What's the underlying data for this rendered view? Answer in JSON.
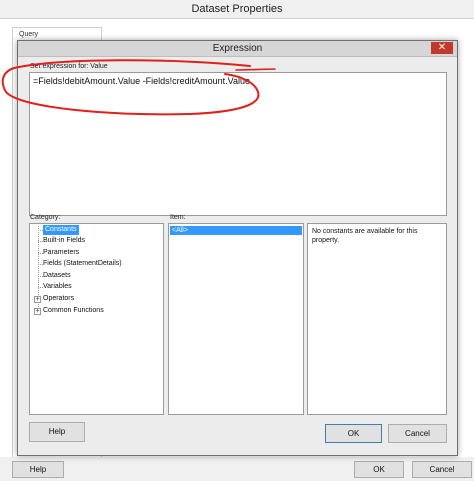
{
  "outer": {
    "title": "Dataset Properties",
    "query_label": "Query",
    "help_label": "Help",
    "ok_label": "OK",
    "cancel_label": "Cancel"
  },
  "dialog": {
    "title": "Expression",
    "close_glyph": "✕",
    "prompt": "Set expression for: Value",
    "expression": "=Fields!debitAmount.Value -Fields!creditAmount.Value",
    "category_label": "Category:",
    "item_label": "Item:",
    "categories": [
      {
        "label": "Constants",
        "selected": true,
        "expandable": false
      },
      {
        "label": "Built-in Fields",
        "selected": false,
        "expandable": false
      },
      {
        "label": "Parameters",
        "selected": false,
        "expandable": false
      },
      {
        "label": "Fields (StatementDetails)",
        "selected": false,
        "expandable": false
      },
      {
        "label": "Datasets",
        "selected": false,
        "expandable": false
      },
      {
        "label": "Variables",
        "selected": false,
        "expandable": false
      },
      {
        "label": "Operators",
        "selected": false,
        "expandable": true
      },
      {
        "label": "Common Functions",
        "selected": false,
        "expandable": true
      }
    ],
    "items": [
      "<All>"
    ],
    "description": "No constants are available for this property.",
    "help_label": "Help",
    "ok_label": "OK",
    "cancel_label": "Cancel",
    "expander_glyph": "+"
  },
  "colors": {
    "selection": "#3399ff",
    "close_button": "#c0392b",
    "annotation_ink": "#e0201a"
  }
}
